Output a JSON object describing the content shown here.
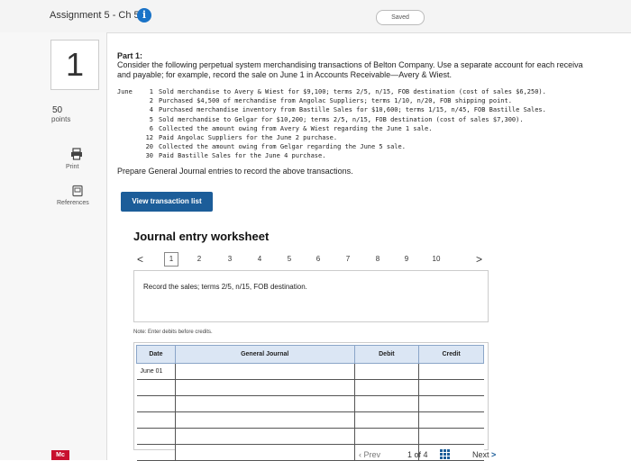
{
  "header": {
    "assignment_title": "Assignment 5 - Ch 5",
    "info_symbol": "i",
    "saved_label": "Saved"
  },
  "sidebar": {
    "question_number": "1",
    "points_value": "50",
    "points_label": "points",
    "print_label": "Print",
    "references_label": "References",
    "logo_text": "Mc"
  },
  "question": {
    "part_label": "Part 1:",
    "intro_line1": "Consider the following perpetual system merchandising transactions of Belton Company. Use a separate account for each receiva",
    "intro_line2": "and payable; for example, record the sale on June 1 in Accounts Receivable—Avery & Wiest.",
    "transactions": [
      {
        "month": "June",
        "day": "1",
        "text": "Sold merchandise to Avery & Wiest for $9,100; terms 2/5, n/15, FOB destination (cost of sales $6,250)."
      },
      {
        "month": "",
        "day": "2",
        "text": "Purchased $4,500 of merchandise from Angolac Suppliers; terms 1/10, n/20, FOB shipping point."
      },
      {
        "month": "",
        "day": "4",
        "text": "Purchased merchandise inventory from Bastille Sales for $10,600; terms 1/15, n/45, FOB Bastille Sales."
      },
      {
        "month": "",
        "day": "5",
        "text": "Sold merchandise to Gelgar for $10,200; terms 2/5, n/15, FOB destination (cost of sales $7,300)."
      },
      {
        "month": "",
        "day": "6",
        "text": "Collected the amount owing from Avery & Wiest regarding the June 1 sale."
      },
      {
        "month": "",
        "day": "12",
        "text": "Paid Angolac Suppliers for the June 2 purchase."
      },
      {
        "month": "",
        "day": "20",
        "text": "Collected the amount owing from Gelgar regarding the June 5 sale."
      },
      {
        "month": "",
        "day": "30",
        "text": "Paid Bastille Sales for the June 4 purchase."
      }
    ],
    "prepare_text": "Prepare General Journal entries to record the above transactions.",
    "view_transaction_label": "View transaction list"
  },
  "worksheet": {
    "title": "Journal entry worksheet",
    "prev_arrow": "<",
    "next_arrow": ">",
    "steps": [
      "1",
      "2",
      "3",
      "4",
      "5",
      "6",
      "7",
      "8",
      "9",
      "10"
    ],
    "active_step": 1,
    "instruction": "Record the sales; terms 2/5, n/15, FOB destination.",
    "note": "Note: Enter debits before credits.",
    "columns": {
      "date": "Date",
      "journal": "General Journal",
      "debit": "Debit",
      "credit": "Credit"
    },
    "rows": [
      {
        "date": "June 01",
        "journal": "",
        "debit": "",
        "credit": ""
      },
      {
        "date": "",
        "journal": "",
        "debit": "",
        "credit": ""
      },
      {
        "date": "",
        "journal": "",
        "debit": "",
        "credit": ""
      },
      {
        "date": "",
        "journal": "",
        "debit": "",
        "credit": ""
      },
      {
        "date": "",
        "journal": "",
        "debit": "",
        "credit": ""
      },
      {
        "date": "",
        "journal": "",
        "debit": "",
        "credit": ""
      }
    ]
  },
  "footer": {
    "prev_label": "Prev",
    "page_indicator": "1 of 4",
    "next_label": "Next",
    "next_arrow": ">"
  },
  "colors": {
    "accent": "#1c5d99",
    "info_icon": "#1a73c7",
    "table_header": "#dbe6f4",
    "logo": "#c8102e"
  }
}
